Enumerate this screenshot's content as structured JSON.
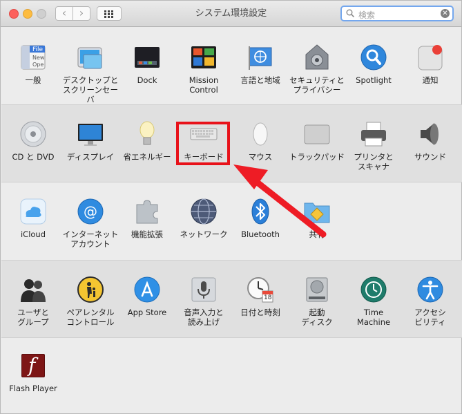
{
  "window": {
    "title": "システム環境設定"
  },
  "toolbar": {
    "back": "‹",
    "forward": "›"
  },
  "search": {
    "placeholder": "検索",
    "clear": "✕"
  },
  "rows": [
    {
      "items": [
        {
          "id": "general",
          "label": "一般",
          "icon": "general-icon"
        },
        {
          "id": "desktop",
          "label": "デスクトップと\nスクリーンセーバ",
          "icon": "desktop-screensaver-icon"
        },
        {
          "id": "dock",
          "label": "Dock",
          "icon": "dock-icon"
        },
        {
          "id": "mission",
          "label": "Mission\nControl",
          "icon": "mission-control-icon"
        },
        {
          "id": "language",
          "label": "言語と地域",
          "icon": "language-region-icon"
        },
        {
          "id": "security",
          "label": "セキュリティと\nプライバシー",
          "icon": "security-privacy-icon"
        },
        {
          "id": "spotlight",
          "label": "Spotlight",
          "icon": "spotlight-icon"
        },
        {
          "id": "notifications",
          "label": "通知",
          "icon": "notifications-icon"
        }
      ]
    },
    {
      "items": [
        {
          "id": "cddvd",
          "label": "CD と DVD",
          "icon": "cd-dvd-icon"
        },
        {
          "id": "display",
          "label": "ディスプレイ",
          "icon": "display-icon"
        },
        {
          "id": "energy",
          "label": "省エネルギー",
          "icon": "energy-saver-icon"
        },
        {
          "id": "keyboard",
          "label": "キーボード",
          "icon": "keyboard-icon"
        },
        {
          "id": "mouse",
          "label": "マウス",
          "icon": "mouse-icon"
        },
        {
          "id": "trackpad",
          "label": "トラックパッド",
          "icon": "trackpad-icon"
        },
        {
          "id": "printers",
          "label": "プリンタと\nスキャナ",
          "icon": "printer-scanner-icon"
        },
        {
          "id": "sound",
          "label": "サウンド",
          "icon": "sound-icon"
        }
      ]
    },
    {
      "items": [
        {
          "id": "icloud",
          "label": "iCloud",
          "icon": "icloud-icon"
        },
        {
          "id": "internet",
          "label": "インターネット\nアカウント",
          "icon": "internet-accounts-icon"
        },
        {
          "id": "extensions",
          "label": "機能拡張",
          "icon": "extensions-icon"
        },
        {
          "id": "network",
          "label": "ネットワーク",
          "icon": "network-icon"
        },
        {
          "id": "bluetooth",
          "label": "Bluetooth",
          "icon": "bluetooth-icon"
        },
        {
          "id": "sharing",
          "label": "共有",
          "icon": "sharing-icon"
        }
      ]
    },
    {
      "items": [
        {
          "id": "users",
          "label": "ユーザと\nグループ",
          "icon": "users-groups-icon"
        },
        {
          "id": "parental",
          "label": "ペアレンタル\nコントロール",
          "icon": "parental-controls-icon"
        },
        {
          "id": "appstore",
          "label": "App Store",
          "icon": "app-store-icon"
        },
        {
          "id": "dictation",
          "label": "音声入力と\n読み上げ",
          "icon": "dictation-speech-icon"
        },
        {
          "id": "datetime",
          "label": "日付と時刻",
          "icon": "date-time-icon"
        },
        {
          "id": "startup",
          "label": "起動\nディスク",
          "icon": "startup-disk-icon"
        },
        {
          "id": "timemachine",
          "label": "Time\nMachine",
          "icon": "time-machine-icon"
        },
        {
          "id": "accessibility",
          "label": "アクセシ\nビリティ",
          "icon": "accessibility-icon"
        }
      ]
    },
    {
      "items": [
        {
          "id": "flash",
          "label": "Flash Player",
          "icon": "flash-player-icon"
        }
      ]
    }
  ],
  "icon_text": {
    "general": [
      "File",
      "New",
      "Ope"
    ],
    "calendar_day": "18",
    "flash": "f"
  },
  "accent": {
    "highlight": "#e8121a",
    "arrow": "#ee1c25"
  }
}
